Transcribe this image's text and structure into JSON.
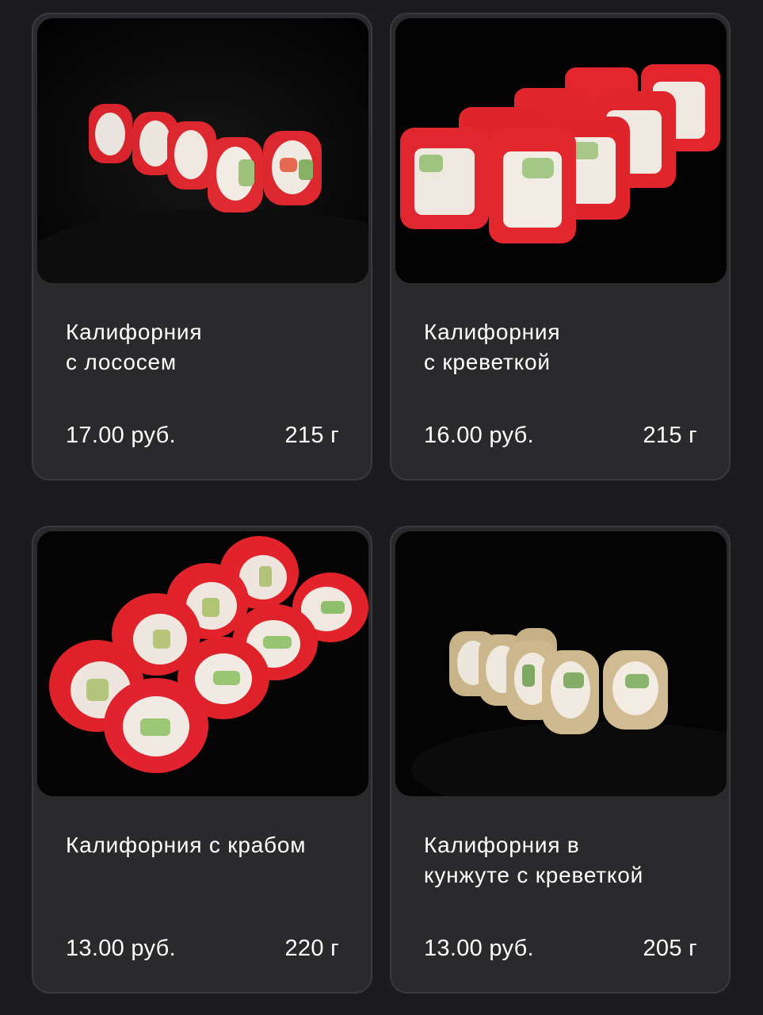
{
  "products": [
    {
      "name": "Калифорния\nс лососем",
      "price": "17.00 руб.",
      "weight": "215 г",
      "image_icon": "california-salmon-roll-photo"
    },
    {
      "name": "Калифорния\nс креветкой",
      "price": "16.00 руб.",
      "weight": "215 г",
      "image_icon": "california-shrimp-roll-photo"
    },
    {
      "name": "Калифорния с крабом",
      "price": "13.00 руб.",
      "weight": "220 г",
      "image_icon": "california-crab-roll-photo"
    },
    {
      "name": "Калифорния в\nкунжуте с креветкой",
      "price": "13.00 руб.",
      "weight": "205 г",
      "image_icon": "california-sesame-shrimp-roll-photo"
    }
  ],
  "colors": {
    "background": "#1c1c1e",
    "card": "#2a2a2c",
    "card_border": "#3a3a3c",
    "tobiko_red": "#e0242c",
    "sesame": "#c9b48a"
  }
}
